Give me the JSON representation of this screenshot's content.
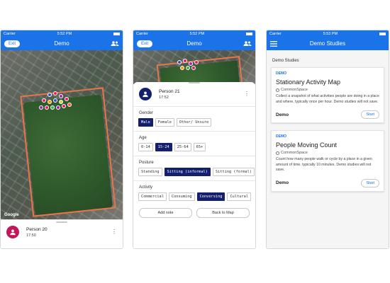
{
  "status_bar": {
    "carrier": "Carrier",
    "time": "5:52 PM",
    "time_right": "5:53 PM"
  },
  "screen1": {
    "title": "Demo",
    "exit_label": "Exit",
    "map_watermark": "Google",
    "person": {
      "name": "Person 20",
      "time": "17:50",
      "avatar_color": "#c2185b"
    }
  },
  "screen2": {
    "title": "Demo",
    "exit_label": "Exit",
    "person": {
      "name": "Person 21",
      "time": "17:52",
      "avatar_color": "#14206e"
    },
    "sections": {
      "gender": {
        "label": "Gender",
        "options": [
          "Male",
          "Female",
          "Other/ Unsure"
        ],
        "selected": 0
      },
      "age": {
        "label": "Age",
        "options": [
          "0-14",
          "15-24",
          "25-64",
          "65+"
        ],
        "selected": 1
      },
      "posture": {
        "label": "Posture",
        "options": [
          "Standing",
          "Sitting (informal)",
          "Sitting (formal)"
        ],
        "selected": 1
      },
      "activity": {
        "label": "Activity",
        "options": [
          "Commercial",
          "Consuming",
          "Conversing",
          "Cultural"
        ],
        "selected": 2
      }
    },
    "add_note_label": "Add note",
    "back_label": "Back to Map"
  },
  "screen3": {
    "title": "Demo Studies",
    "section_heading": "Demo Studies",
    "cards": [
      {
        "tag": "DEMO",
        "title": "Stationary Activity Map",
        "org": "CommonSpace",
        "description": "Collect a snapshot of what activities people are doing in a place and where, typically once per hour. Demo studies will not save.",
        "footer_label": "Demo",
        "action_label": "Start"
      },
      {
        "tag": "DEMO",
        "title": "People Moving Count",
        "org": "CommonSpace",
        "description": "Count how many people walk or cycle by a place in a given amount of time, typically 10 minutes. Demo studies will not save.",
        "footer_label": "Demo",
        "action_label": "Start"
      }
    ]
  },
  "colors": {
    "primary": "#1a73e8",
    "selected_chip": "#14206e",
    "park_border": "#e8754a"
  }
}
